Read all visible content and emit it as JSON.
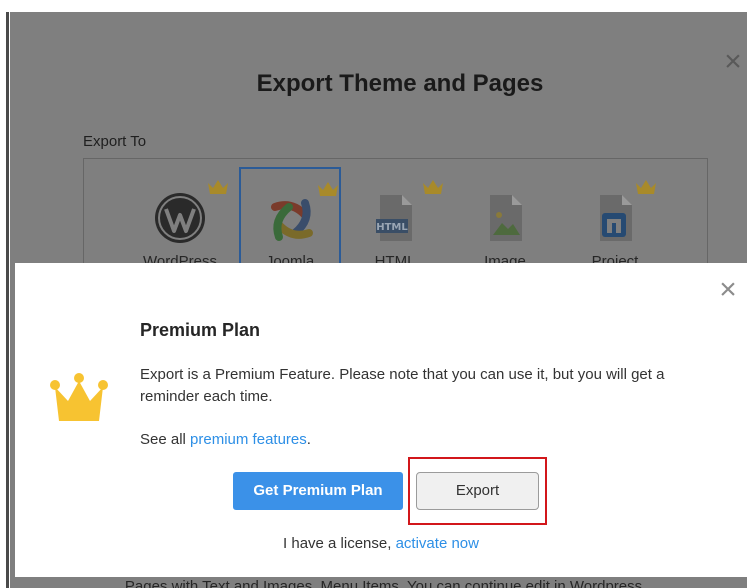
{
  "background_dialog": {
    "title": "Export Theme and Pages",
    "export_to_label": "Export To",
    "close_glyph": "×",
    "targets": [
      {
        "label": "WordPress",
        "icon": "wordpress-icon",
        "premium": true,
        "selected": false
      },
      {
        "label": "Joomla",
        "icon": "joomla-icon",
        "premium": true,
        "selected": true
      },
      {
        "label": "HTML",
        "icon": "html-file-icon",
        "premium": true,
        "selected": false
      },
      {
        "label": "Image",
        "icon": "image-file-icon",
        "premium": false,
        "selected": false
      },
      {
        "label": "Project",
        "icon": "project-file-icon",
        "premium": true,
        "selected": false
      }
    ],
    "bottom_text": "Pages with Text and Images, Menu Items. You can continue edit in Wordpress"
  },
  "modal": {
    "title": "Premium Plan",
    "body": "Export is a Premium Feature. Please note that you can use it, but you will get a reminder each time.",
    "see_all_prefix": "See all ",
    "see_all_link": "premium features",
    "see_all_suffix": ".",
    "get_premium_label": "Get Premium Plan",
    "export_label": "Export",
    "license_prefix": "I have a license, ",
    "license_link": "activate now",
    "close_glyph": "×"
  },
  "colors": {
    "overlay": "#7f7f7f",
    "crown": "#f7c331",
    "primary_button": "#3b91e8",
    "link": "#2d8fe6",
    "highlight": "#d2171b"
  }
}
